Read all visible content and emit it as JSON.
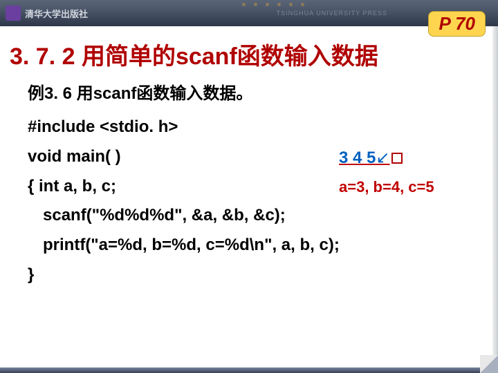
{
  "header": {
    "logo_text": "清华大学出版社",
    "press_en": "TSINGHUA UNIVERSITY PRESS"
  },
  "page_badge": "P 70",
  "section_title": "3. 7. 2 用简单的scanf函数输入数据",
  "example_title": "例3. 6 用scanf函数输入数据。",
  "code": {
    "l1": "#include <stdio. h>",
    "l2": "void main( )",
    "l3": "{ int a, b, c;",
    "l4": "scanf(\"%d%d%d\", &a, &b, &c);",
    "l5": "printf(\"a=%d, b=%d, c=%d\\n\", a, b, c);",
    "l6": "}"
  },
  "io": {
    "input": "3 4 5",
    "enter": "↙",
    "output": "a=3, b=4, c=5"
  }
}
